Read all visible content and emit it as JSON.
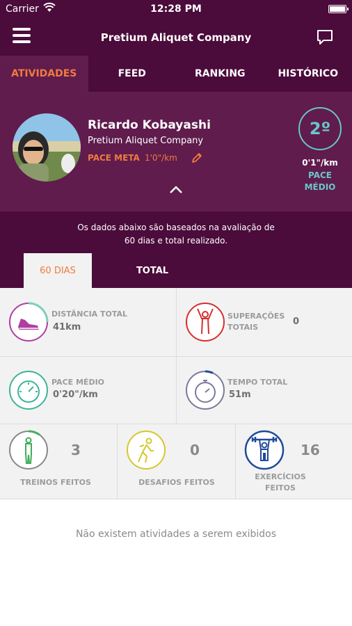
{
  "status": {
    "carrier": "Carrier",
    "time": "12:28 PM"
  },
  "navbar": {
    "title": "Pretium Aliquet Company"
  },
  "tabs": [
    {
      "label": "ATIVIDADES",
      "active": true
    },
    {
      "label": "FEED",
      "active": false
    },
    {
      "label": "RANKING",
      "active": false
    },
    {
      "label": "HISTÓRICO",
      "active": false
    }
  ],
  "profile": {
    "name": "Ricardo Kobayashi",
    "company": "Pretium Aliquet Company",
    "pace_meta_label": "PACE META",
    "pace_meta_value": "1'0\"/km",
    "rank": "2º",
    "pace_value": "0'1\"/km",
    "pace_label_line1": "PACE",
    "pace_label_line2": "MÉDIO"
  },
  "info": {
    "text_line1": "Os dados abaixo são baseados na avaliação de",
    "text_line2": "60 dias e total realizado."
  },
  "segments": {
    "active": "60 DIAS",
    "inactive": "TOTAL"
  },
  "stats": {
    "distance": {
      "label": "DISTÂNCIA TOTAL",
      "value": "41km",
      "color": "#b03fa0"
    },
    "superacoes": {
      "label_line1": "SUPERAÇÕES",
      "label_line2": "TOTAIS",
      "value": "0",
      "color": "#d62e2e"
    },
    "pace": {
      "label": "PACE MÉDIO",
      "value": "0'20\"/km",
      "color": "#3fb39a"
    },
    "tempo": {
      "label": "TEMPO TOTAL",
      "value": "51m",
      "color": "#7a7a9a"
    },
    "treinos": {
      "label": "TREINOS FEITOS",
      "value": "3",
      "color": "#3fae5a"
    },
    "desafios": {
      "label": "DESAFIOS FEITOS",
      "value": "0",
      "color": "#d6c72a"
    },
    "exercicios": {
      "label_line1": "EXERCÍCIOS",
      "label_line2": "FEITOS",
      "value": "16",
      "color": "#1f4a9a"
    }
  },
  "empty_message": "Não existem atividades a serem exibidos",
  "colors": {
    "primary": "#4b0b3b",
    "primary_light": "#5f1c4d",
    "accent": "#f07a3f",
    "teal": "#6ac6c9"
  }
}
